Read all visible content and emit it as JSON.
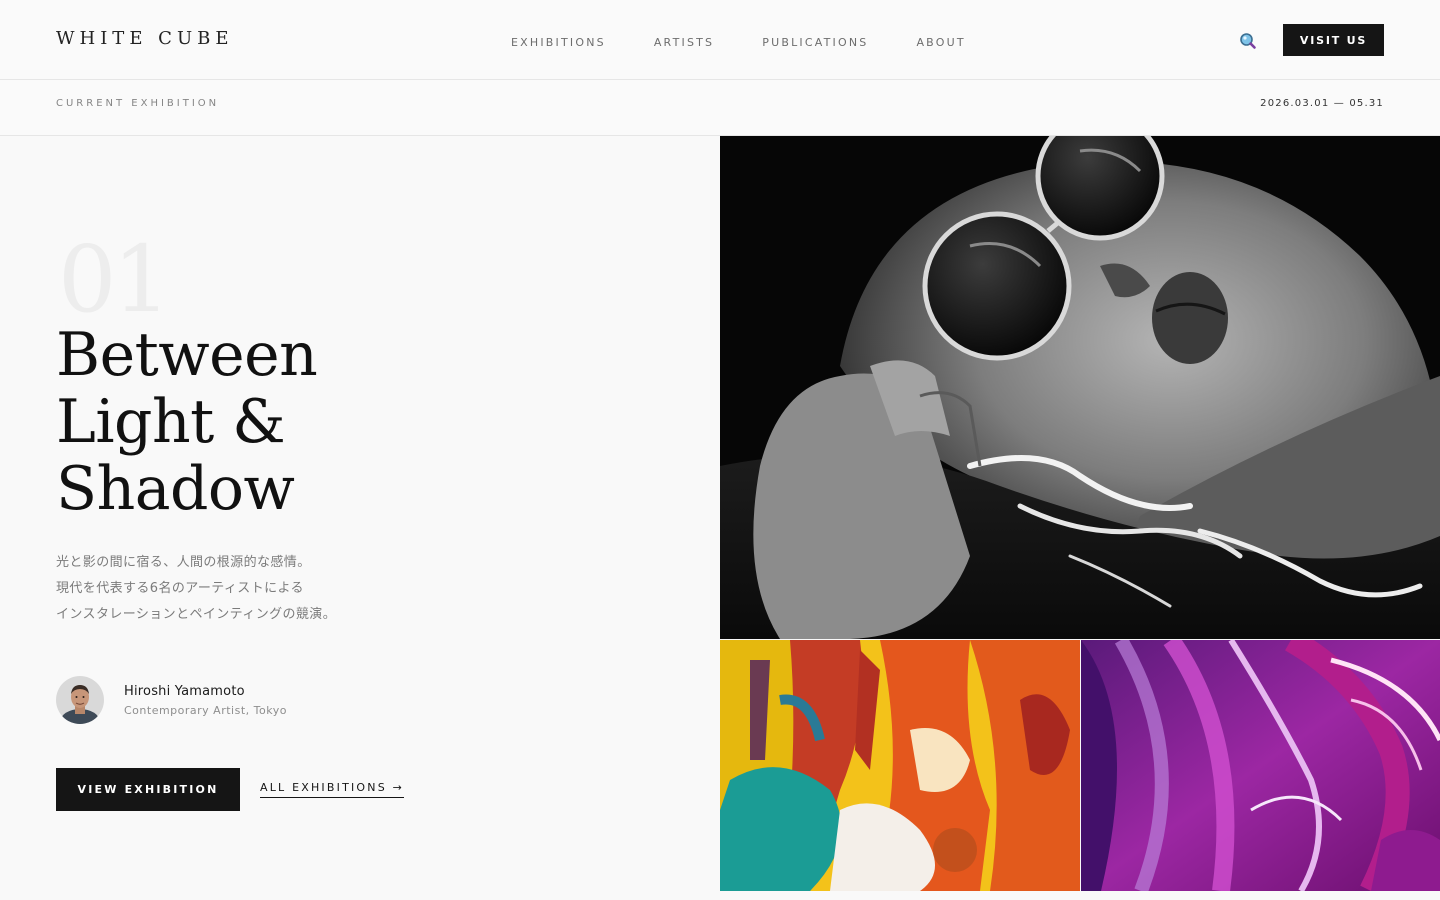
{
  "brand": {
    "logo": "WHITE CUBE"
  },
  "nav": {
    "items": [
      {
        "label": "EXHIBITIONS"
      },
      {
        "label": "ARTISTS"
      },
      {
        "label": "PUBLICATIONS"
      },
      {
        "label": "ABOUT"
      }
    ]
  },
  "header": {
    "visit_label": "VISIT US",
    "search_icon": "search-icon"
  },
  "subheader": {
    "section_label": "CURRENT EXHIBITION",
    "date_range": "2026.03.01 — 05.31"
  },
  "exhibition": {
    "number": "01",
    "title_lines": [
      "Between",
      "Light &",
      "Shadow"
    ],
    "description_lines": [
      "光と影の間に宿る、人間の根源的な感情。",
      "現代を代表する6名のアーティストによる",
      "インスタレーションとペインティングの競演。"
    ],
    "artist": {
      "name": "Hiroshi Yamamoto",
      "role": "Contemporary Artist, Tokyo"
    },
    "primary_cta": "VIEW  EXHIBITION",
    "secondary_cta": "ALL  EXHIBITIONS →"
  },
  "images": {
    "hero": "black-and-white portrait with round sunglasses in water",
    "art_1": "colorful abstract acrylic painting",
    "art_2": "purple and magenta abstract fluid paint"
  },
  "colors": {
    "primary_dark": "#151515",
    "background": "#f9f9f9",
    "muted_text": "#7b7b7b"
  }
}
